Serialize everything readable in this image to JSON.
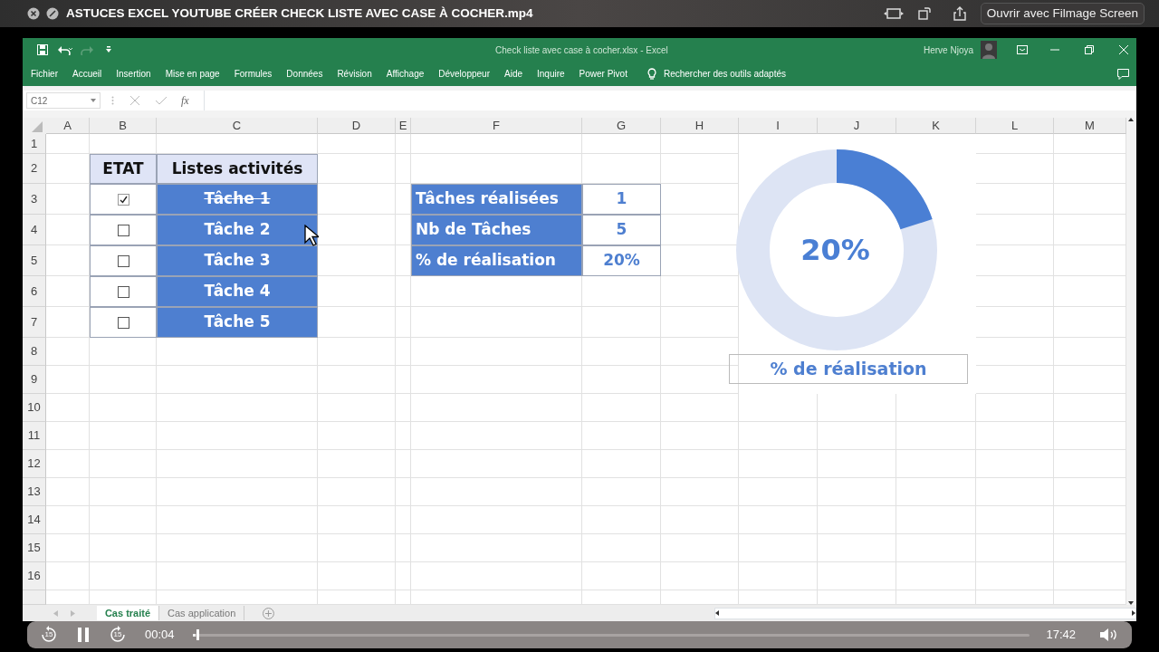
{
  "player": {
    "title": "ASTUCES EXCEL YOUTUBE CRÉER CHECK LISTE AVEC CASE À COCHER.mp4",
    "open_button": "Ouvrir avec Filmage Screen",
    "skip_back": "15",
    "skip_forward": "15",
    "playing": true,
    "elapsed": "00:04",
    "progress": {
      "level": 0.004
    },
    "duration": "17:42"
  },
  "excel": {
    "title": "Check liste avec case à cocher.xlsx  -  Excel",
    "user": "Herve Njoya",
    "redo": {
      "disabled": true
    },
    "tabs": [
      "Fichier",
      "Accueil",
      "Insertion",
      "Mise en page",
      "Formules",
      "Données",
      "Révision",
      "Affichage",
      "Développeur",
      "Aide",
      "Inquire",
      "Power Pivot"
    ],
    "search": "Rechercher des outils adaptés",
    "name_box": "C12",
    "fx": "fx",
    "columns": [
      "A",
      "B",
      "C",
      "D",
      "E",
      "F",
      "G",
      "H",
      "I",
      "J",
      "K",
      "L",
      "M"
    ],
    "rows": [
      "1",
      "2",
      "3",
      "4",
      "5",
      "6",
      "7",
      "8",
      "9",
      "10",
      "11",
      "12",
      "13",
      "14",
      "15",
      "16"
    ],
    "checklist": {
      "headers": [
        "ETAT",
        "Listes activités"
      ],
      "tasks": [
        {
          "label": "Tâche 1",
          "checked": true
        },
        {
          "label": "Tâche 2",
          "checked": false
        },
        {
          "label": "Tâche 3",
          "checked": false
        },
        {
          "label": "Tâche 4",
          "checked": false
        },
        {
          "label": "Tâche 5",
          "checked": false
        }
      ]
    },
    "summary": [
      {
        "label": "Tâches réalisées",
        "value": "1"
      },
      {
        "label": "Nb de Tâches",
        "value": "5"
      },
      {
        "label": "% de réalisation",
        "value": "20%"
      }
    ],
    "donut": {
      "level": 0.2,
      "label": "20%",
      "caption": "% de réalisation"
    },
    "sheets": [
      {
        "label": "Cas traité",
        "selected": true
      },
      {
        "label": "Cas application",
        "selected": false
      }
    ]
  }
}
